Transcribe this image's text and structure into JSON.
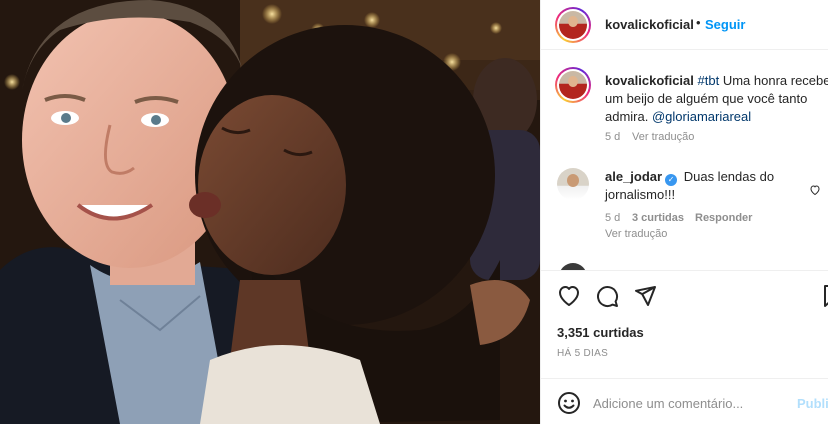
{
  "post": {
    "username": "kovalickoficial",
    "follow_label": "Seguir",
    "separator": "•"
  },
  "caption": {
    "username": "kovalickoficial",
    "hashtag": "#tbt",
    "text": "Uma honra receber um beijo de alguém que você tanto admira.",
    "mention": "@gloriamariareal",
    "time": "5 d",
    "translate": "Ver tradução"
  },
  "comments": [
    {
      "username": "ale_jodar",
      "verified": true,
      "text": "Duas lendas do jornalismo!!!",
      "time": "5 d",
      "likes": "3 curtidas",
      "reply": "Responder",
      "translate": "Ver tradução"
    }
  ],
  "actions": {
    "icons": [
      "heart-icon",
      "comment-icon",
      "share-icon",
      "bookmark-icon"
    ],
    "likes": "3,351 curtidas",
    "posted": "HÁ 5 DIAS"
  },
  "comment_bar": {
    "placeholder": "Adicione um comentário...",
    "publish_label": "Publicar"
  },
  "colors": {
    "accent": "#0095f6",
    "link": "#00376b",
    "muted": "#8e8e8e",
    "verified": "#3897f0",
    "publish_disabled": "#b2dffc"
  }
}
